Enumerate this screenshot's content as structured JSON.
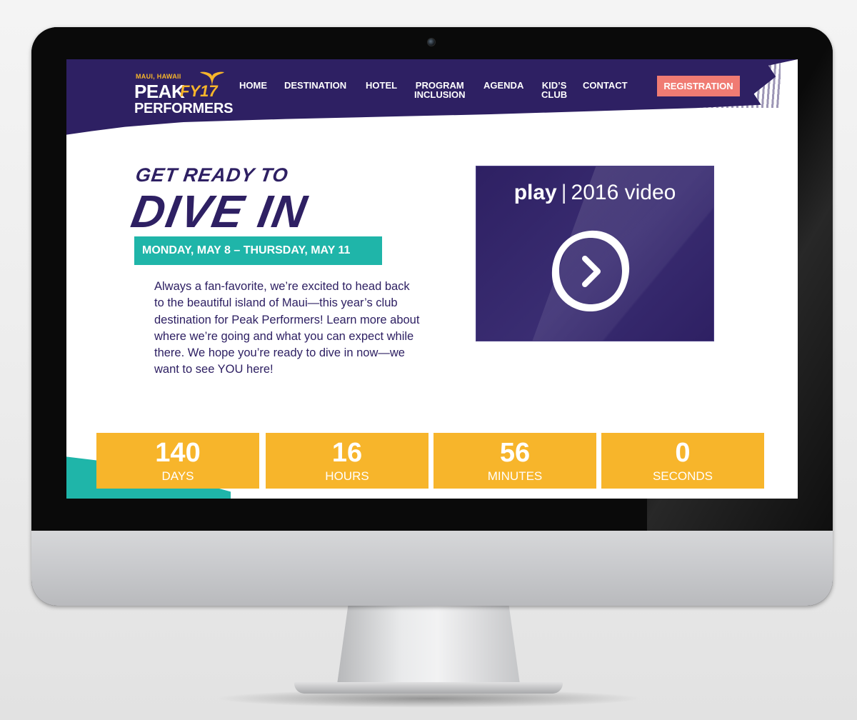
{
  "logo": {
    "location": "MAUI, HAWAII",
    "peak": "PEAK",
    "fy": "FY17",
    "performers": "PERFORMERS"
  },
  "nav": {
    "items": [
      {
        "label": "HOME"
      },
      {
        "label": "DESTINATION"
      },
      {
        "label": "HOTEL"
      },
      {
        "label": "PROGRAM\nINCLUSION"
      },
      {
        "label": "AGENDA"
      },
      {
        "label": "KID’S\nCLUB"
      },
      {
        "label": "CONTACT"
      }
    ],
    "registration_label": "REGISTRATION"
  },
  "hero": {
    "pre_title": "GET READY TO",
    "title": "DIVE IN",
    "dates": "MONDAY, MAY 8 – THURSDAY, MAY 11",
    "intro": "Always a fan-favorite, we’re excited to head back to the beautiful island of Maui—this year’s club destination for Peak Performers! Learn more about where we’re going and what you can expect while there. We hope you’re ready to dive in now—we want to see YOU here!"
  },
  "video": {
    "play_word": "play",
    "separator": "|",
    "label": "2016 video",
    "icon": "play-circle-icon"
  },
  "countdown": {
    "days": {
      "value": "140",
      "label": "DAYS"
    },
    "hours": {
      "value": "16",
      "label": "HOURS"
    },
    "minutes": {
      "value": "56",
      "label": "MINUTES"
    },
    "seconds": {
      "value": "0",
      "label": "SECONDS"
    }
  },
  "colors": {
    "brand_purple": "#2e2063",
    "teal": "#1fb5a9",
    "gold": "#f7b52b",
    "registration": "#f07b73"
  }
}
